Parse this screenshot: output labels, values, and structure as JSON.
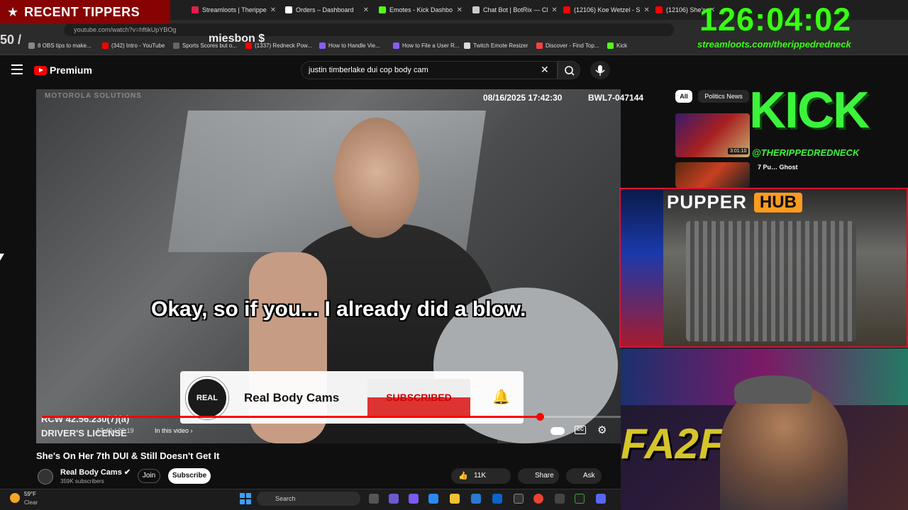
{
  "browser": {
    "tabs": [
      {
        "label": "Streamloots | Therippe",
        "color": "#e0204a"
      },
      {
        "label": "Orders – Dashboard",
        "color": "#ffffff"
      },
      {
        "label": "Emotes - Kick Dashbo",
        "color": "#53fc18"
      },
      {
        "label": "Chat Bot | BotRix — Cl",
        "color": "#cccccc"
      },
      {
        "label": "(12106) Koe Wetzel - S",
        "color": "#ff0000"
      },
      {
        "label": "(12106) She's",
        "color": "#ff0000"
      }
    ],
    "url": "youtube.com/watch?v=hftikUpYBOg",
    "bookmarks": [
      {
        "label": "8 OBS tips to make...",
        "color": "#888888"
      },
      {
        "label": "(342) Intro - YouTube",
        "color": "#ff0000"
      },
      {
        "label": "Sports Scores but o...",
        "color": "#666666"
      },
      {
        "label": "(1337) Redneck Pow...",
        "color": "#ff0000"
      },
      {
        "label": "How to Handle Vie...",
        "color": "#8a5cf6"
      },
      {
        "label": "How to File a User R...",
        "color": "#8a5cf6"
      },
      {
        "label": "Twitch Emote Resizer",
        "color": "#dddddd"
      },
      {
        "label": "Discover - Find Top...",
        "color": "#ff4040"
      },
      {
        "label": "Kick",
        "color": "#53fc18"
      }
    ]
  },
  "overlay": {
    "tippers_title": "RECENT TIPPERS",
    "tip_count": "50 /",
    "tipper_name": "miesbon $",
    "timer": "126:04:02",
    "stream_url": "streamloots.com/therippedredneck",
    "kick_title": "KICK",
    "kick_handle": "@THERIPPEDREDNECK",
    "pupper_label_1": "PUPPER",
    "pupper_label_2": "HUB",
    "graffiti": "FA2FO",
    "timer_color": "#39ff14"
  },
  "youtube": {
    "logo_word": "Premium",
    "search_value": "justin timberlake dui cop body cam",
    "chips": [
      "All",
      "Politics News"
    ],
    "sidebar": {
      "thumb1_duration": "3:01:10",
      "thumb2_title": "7 Pu… Ghost"
    }
  },
  "video": {
    "watermark": "MOTOROLA SOLUTIONS",
    "cam_date": "08/16/2025 17:42:30",
    "cam_id": "BWL7-047144",
    "subtitle": "Okay, so if you... I already did a blow.",
    "rcw_text": "RCW 42.56.230(7)(a)",
    "license_text": "DRIVER'S LICENSE",
    "subscribe_card": {
      "channel": "Real Body Cams",
      "logo_text": "REAL",
      "button": "SUBSCRIBED"
    },
    "progress": 0.86,
    "time": "17:40 / 22:19",
    "in_video": "In this video ›",
    "title": "She's On Her 7th DUI & Still Doesn't Get It"
  },
  "channel": {
    "name": "Real Body Cams ✔",
    "subs": "359K subscribers",
    "join": "Join",
    "subscribe": "Subscribe",
    "likes": "11K",
    "share": "Share",
    "ask": "Ask"
  },
  "taskbar": {
    "temp": "59°F",
    "condition": "Clear",
    "search": "Search"
  }
}
